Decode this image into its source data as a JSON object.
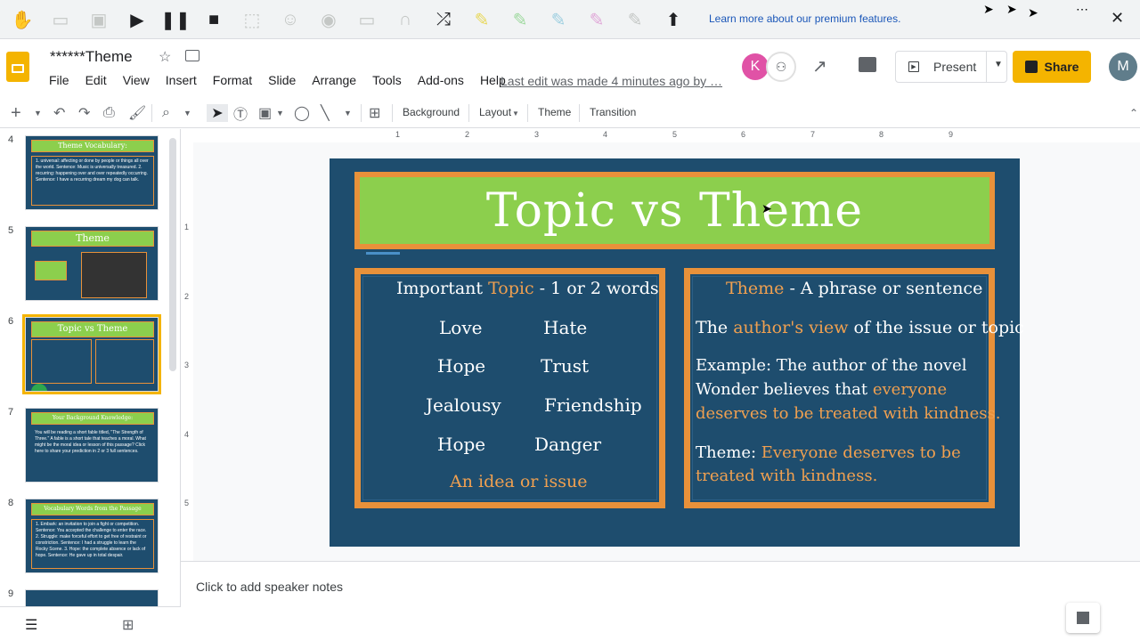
{
  "extension_bar": {
    "premium_link": "Learn more about our premium features.",
    "icons": [
      "hand-icon",
      "book-icon",
      "image-icon",
      "play-icon",
      "pause-icon",
      "stop-icon",
      "select-icon",
      "speech-icon",
      "eye-icon",
      "screen-icon",
      "headphones-icon",
      "shuffle-icon",
      "highlight-yellow-icon",
      "highlight-green-icon",
      "highlight-blue-icon",
      "highlight-pink-icon",
      "highlight-clear-icon",
      "upload-icon"
    ]
  },
  "header": {
    "doc_title": "******Theme",
    "menu": [
      "File",
      "Edit",
      "View",
      "Insert",
      "Format",
      "Slide",
      "Arrange",
      "Tools",
      "Add-ons",
      "Help"
    ],
    "last_edit": "Last edit was made 4 minutes ago by …",
    "avatar_k": "K",
    "avatar_m": "M",
    "present_label": "Present",
    "share_label": "Share"
  },
  "toolbar": {
    "background_label": "Background",
    "layout_label": "Layout",
    "theme_label": "Theme",
    "transition_label": "Transition"
  },
  "ruler": {
    "h_ticks": [
      "1",
      "2",
      "3",
      "4",
      "5",
      "6",
      "7",
      "8",
      "9"
    ],
    "v_ticks": [
      "1",
      "2",
      "3",
      "4",
      "5"
    ]
  },
  "filmstrip": {
    "slides": [
      {
        "num": "4",
        "title": "Theme Vocabulary:",
        "body": "1. universal: affecting or done by people or things all over the world. Sentence: Music is universally treasured. 2. recurring: happening over and over repeatedly occurring. Sentence: I have a recurring dream my dog can talk."
      },
      {
        "num": "5",
        "title": "Theme",
        "body": ""
      },
      {
        "num": "6",
        "title": "Topic vs Theme",
        "body": ""
      },
      {
        "num": "7",
        "title": "Your Background Knowledge:",
        "body": "You will be reading a short fable titled, \"The Strength of Three.\" A fable is a short tale that teaches a moral. What might be the moral idea or lesson of this passage? Click here to share your prediction in 2 or 3 full sentences."
      },
      {
        "num": "8",
        "title": "Vocabulary Words from the Passage",
        "body": "1. Embark: an invitation to join a fight or competition. Sentence: You accepted the challenge to enter the race. 2. Struggle: make forceful effort to get free of restraint or constriction. Sentence: I had a struggle to learn the Rocky Scene. 3. Hope: the complete absence or lack of hope. Sentence: He gave up in total despair."
      },
      {
        "num": "9",
        "title": "",
        "body": ""
      }
    ]
  },
  "slide": {
    "title": "Topic vs Theme",
    "left_card": {
      "heading_prefix": "Important ",
      "heading_accent": "Topic",
      "heading_suffix": " - 1 or 2 words",
      "words": [
        "Love",
        "Hate",
        "Hope",
        "Trust",
        "Jealousy",
        "Friendship",
        "Hope",
        "Danger"
      ],
      "footer": "An idea or issue"
    },
    "right_card": {
      "heading_accent": "Theme",
      "heading_suffix": " - A phrase or sentence",
      "line1_prefix": "The ",
      "line1_accent": "author's view",
      "line1_suffix": " of the issue or topic",
      "example_line1": "Example: The author  of the novel",
      "example_line2_prefix": "Wonder believes that ",
      "example_line2_accent": "everyone",
      "example_line3": "deserves to be treated with kindness.",
      "theme_prefix": "Theme: ",
      "theme_line1": "Everyone deserves to be",
      "theme_line2": "treated with kindness."
    }
  },
  "speaker_notes_placeholder": "Click to add speaker notes",
  "colors": {
    "slide_bg": "#1e4d6e",
    "title_green": "#8ccf4d",
    "accent_orange": "#e8913a",
    "share_yellow": "#f4b400"
  }
}
